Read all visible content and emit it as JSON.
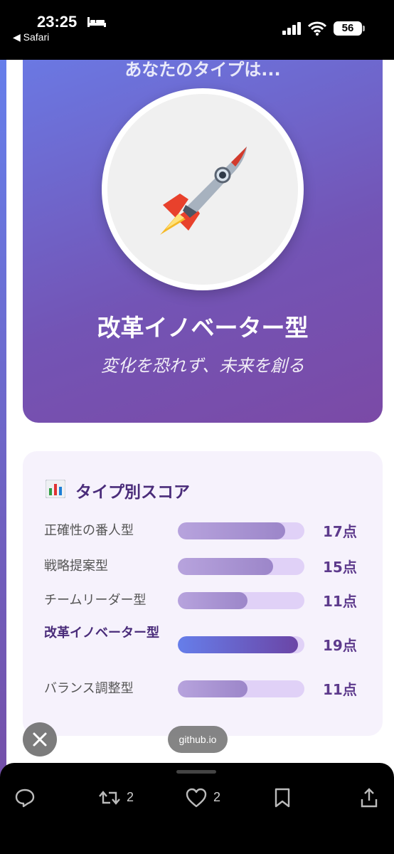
{
  "status_bar": {
    "time": "23:25",
    "back_app": "◀ Safari",
    "battery": "56",
    "icons": [
      "bed-icon",
      "signal-icon",
      "wifi-icon",
      "battery-icon"
    ]
  },
  "hero": {
    "heading": "あなたのタイプは...",
    "avatar_icon": "rocket-icon",
    "type_name": "改革イノベーター型",
    "tagline": "変化を恐れず、未来を創る"
  },
  "scores": {
    "title": "タイプ別スコア",
    "icon": "bar-chart-icon",
    "max_points": 20,
    "rows": [
      {
        "label": "正確性の番人型",
        "points": 17,
        "value_text": "17点",
        "active": false
      },
      {
        "label": "戦略提案型",
        "points": 15,
        "value_text": "15点",
        "active": false
      },
      {
        "label": "チームリーダー型",
        "points": 11,
        "value_text": "11点",
        "active": false
      },
      {
        "label": "改革イノベーター型",
        "points": 19,
        "value_text": "19点",
        "active": true
      },
      {
        "label": "バランス調整型",
        "points": 11,
        "value_text": "11点",
        "active": false
      }
    ],
    "colors": {
      "bar": "#a896d4",
      "active_start": "#667eea",
      "active_end": "#6b45a6",
      "track": "#e0d1f7"
    }
  },
  "overlay": {
    "domain": "github.io",
    "close_icon": "close-icon"
  },
  "bottom_bar": {
    "reply_icon": "reply-icon",
    "retweet_icon": "retweet-icon",
    "retweet_count": "2",
    "like_icon": "heart-icon",
    "like_count": "2",
    "bookmark_icon": "bookmark-icon",
    "share_icon": "share-icon"
  }
}
